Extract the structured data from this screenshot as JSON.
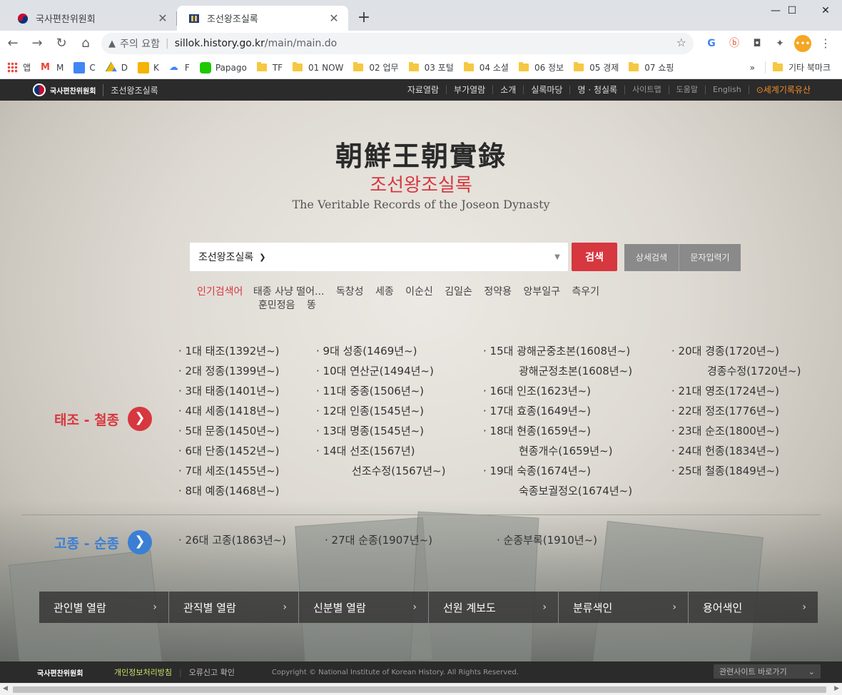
{
  "browser": {
    "tabs": [
      {
        "title": "국사편찬위원회",
        "active": false
      },
      {
        "title": "조선왕조실록",
        "active": true
      }
    ],
    "new_tab": "+",
    "window_controls": {
      "minimize": "—",
      "maximize": "☐",
      "close": "✕"
    },
    "omnibox": {
      "security_warning": "주의 요함",
      "host": "sillok.history.go.kr",
      "path": "/main/main.do"
    },
    "bookmarks": [
      {
        "label": "앱",
        "icon": "apps-icon"
      },
      {
        "label": "M",
        "icon": "gmail-icon"
      },
      {
        "label": "C",
        "icon": "calendar-icon"
      },
      {
        "label": "D",
        "icon": "drive-icon"
      },
      {
        "label": "K",
        "icon": "keep-icon"
      },
      {
        "label": "F",
        "icon": "cloud-icon"
      },
      {
        "label": "Papago",
        "icon": "papago-icon"
      },
      {
        "label": "TF",
        "icon": "folder-icon"
      },
      {
        "label": "01 NOW",
        "icon": "folder-icon"
      },
      {
        "label": "02 업무",
        "icon": "folder-icon"
      },
      {
        "label": "03 포털",
        "icon": "folder-icon"
      },
      {
        "label": "04 소셜",
        "icon": "folder-icon"
      },
      {
        "label": "06 정보",
        "icon": "folder-icon"
      },
      {
        "label": "05 경제",
        "icon": "folder-icon"
      },
      {
        "label": "07 쇼핑",
        "icon": "folder-icon"
      }
    ],
    "bookmarks_overflow": "»",
    "other_bookmarks": "기타 북마크"
  },
  "site_header": {
    "org_logo": "국사편찬위원회",
    "site_name": "조선왕조실록",
    "nav": [
      {
        "label": "자료열람",
        "dim": false
      },
      {
        "label": "부가열람",
        "dim": false
      },
      {
        "label": "소개",
        "dim": false
      },
      {
        "label": "실록마당",
        "dim": false
      },
      {
        "label": "명 · 청실록",
        "dim": false
      },
      {
        "label": "사이트맵",
        "dim": true
      },
      {
        "label": "도움말",
        "dim": true
      },
      {
        "label": "English",
        "dim": true
      }
    ],
    "memory_of_world": "세계기록유산"
  },
  "hero": {
    "title_hanja": "朝鮮王朝實錄",
    "title_korean": "조선왕조실록",
    "title_english": "The Veritable Records of the Joseon Dynasty"
  },
  "search": {
    "scope_selected": "조선왕조실록",
    "input_value": "",
    "submit_label": "검색",
    "advanced_label": "상세검색",
    "char_input_label": "문자입력기"
  },
  "popular": {
    "label": "인기검색어",
    "row1": [
      "태종 사냥 떨어...",
      "독창성",
      "세종",
      "이순신",
      "김일손",
      "정약용",
      "앙부일구",
      "측우기"
    ],
    "row2": [
      "훈민정음",
      "똥"
    ]
  },
  "section_early": {
    "label": "태조 - 철종",
    "accent": "#d7373f",
    "col1": [
      "· 1대 태조(1392년~)",
      "· 2대 정종(1399년~)",
      "· 3대 태종(1401년~)",
      "· 4대 세종(1418년~)",
      "· 5대 문종(1450년~)",
      "· 6대 단종(1452년~)",
      "· 7대 세조(1455년~)",
      "· 8대 예종(1468년~)"
    ],
    "col2": [
      "· 9대 성종(1469년~)",
      "· 10대 연산군(1494년~)",
      "· 11대 중종(1506년~)",
      "· 12대 인종(1545년~)",
      "· 13대 명종(1545년~)",
      "· 14대 선조(1567년)",
      "선조수정(1567년~)"
    ],
    "col3": [
      "· 15대 광해군중초본(1608년~)",
      "광해군정초본(1608년~)",
      "· 16대 인조(1623년~)",
      "· 17대 효종(1649년~)",
      "· 18대 현종(1659년~)",
      "현종개수(1659년~)",
      "· 19대 숙종(1674년~)",
      "숙종보궐정오(1674년~)"
    ],
    "col4": [
      "· 20대 경종(1720년~)",
      "경종수정(1720년~)",
      "· 21대 영조(1724년~)",
      "· 22대 정조(1776년~)",
      "· 23대 순조(1800년~)",
      "· 24대 헌종(1834년~)",
      "· 25대 철종(1849년~)"
    ]
  },
  "section_late": {
    "label": "고종 - 순종",
    "accent": "#3b7fd4",
    "items": [
      "· 26대 고종(1863년~)",
      "· 27대 순종(1907년~)",
      "· 순종부록(1910년~)"
    ]
  },
  "tiles": [
    "관인별 열람",
    "관직별 열람",
    "신분별 열람",
    "선원 계보도",
    "분류색인",
    "용어색인"
  ],
  "footer": {
    "logo": "국사편찬위원회",
    "privacy": "개인정보처리방침",
    "report": "오류신고 확인",
    "copyright": "Copyright © National Institute of Korean History. All Rights Reserved.",
    "related_sites": "관련사이트 바로가기"
  }
}
